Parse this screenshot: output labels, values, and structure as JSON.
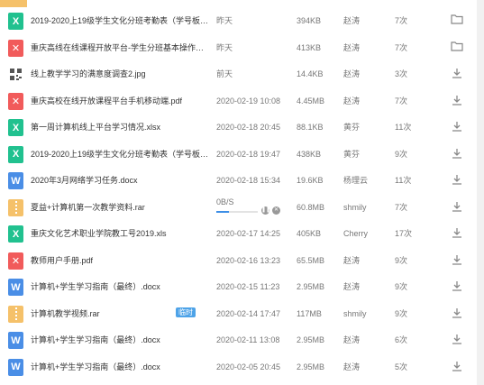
{
  "files": [
    {
      "type": "xls",
      "color": "#21c18f",
      "glyph": "X",
      "name": "2019-2020上19级学生文化分班考勤表（学号板…",
      "date": "昨天",
      "size": "394KB",
      "owner": "赵涛",
      "count": "7次",
      "action": "folder-icon"
    },
    {
      "type": "pdf",
      "color": "#f15b5b",
      "glyph": "✕",
      "name": "重庆高线在线课程开放平台-学生分班基本操作流…",
      "date": "昨天",
      "size": "413KB",
      "owner": "赵涛",
      "count": "7次",
      "action": "folder-icon"
    },
    {
      "type": "jpg",
      "color": "#777777",
      "glyph": "▦",
      "name": "线上教学学习的满意度调查2.jpg",
      "date": "前天",
      "size": "14.4KB",
      "owner": "赵涛",
      "count": "3次",
      "action": "download-icon"
    },
    {
      "type": "pdf",
      "color": "#f15b5b",
      "glyph": "✕",
      "name": "重庆高校在线开放课程平台手机移动端.pdf",
      "date": "2020-02-19 10:08",
      "size": "4.45MB",
      "owner": "赵涛",
      "count": "7次",
      "action": "download-icon"
    },
    {
      "type": "xls",
      "color": "#21c18f",
      "glyph": "X",
      "name": "第一周计算机线上平台学习情况.xlsx",
      "date": "2020-02-18 20:45",
      "size": "88.1KB",
      "owner": "黄芬",
      "count": "11次",
      "action": "download-icon"
    },
    {
      "type": "xls",
      "color": "#21c18f",
      "glyph": "X",
      "name": "2019-2020上19级学生文化分班考勤表（学号板…",
      "date": "2020-02-18 19:47",
      "size": "438KB",
      "owner": "黄芬",
      "count": "9次",
      "action": "download-icon"
    },
    {
      "type": "doc",
      "color": "#4a8ee6",
      "glyph": "W",
      "name": "2020年3月网络学习任务.docx",
      "date": "2020-02-18 15:34",
      "size": "19.6KB",
      "owner": "杨理云",
      "count": "11次",
      "action": "download-icon"
    },
    {
      "type": "rar",
      "color": "#f5c16a",
      "glyph": "▮",
      "name": "夏益+计算机第一次教学资料.rar",
      "date": "",
      "size": "60.8MB",
      "owner": "shmily",
      "count": "7次",
      "action": "download-icon",
      "progress": {
        "speed": "0B/S",
        "percent": 30
      }
    },
    {
      "type": "xls",
      "color": "#21c18f",
      "glyph": "X",
      "name": "重庆文化艺术职业学院教工号2019.xls",
      "date": "2020-02-17 14:25",
      "size": "405KB",
      "owner": "Cherry",
      "count": "17次",
      "action": "download-icon"
    },
    {
      "type": "pdf",
      "color": "#f15b5b",
      "glyph": "✕",
      "name": "教师用户手册.pdf",
      "date": "2020-02-16 13:23",
      "size": "65.5MB",
      "owner": "赵涛",
      "count": "9次",
      "action": "download-icon"
    },
    {
      "type": "doc",
      "color": "#4a8ee6",
      "glyph": "W",
      "name": "计算机+学生学习指南（最终）.docx",
      "date": "2020-02-15 11:23",
      "size": "2.95MB",
      "owner": "赵涛",
      "count": "9次",
      "action": "download-icon"
    },
    {
      "type": "rar",
      "color": "#f5c16a",
      "glyph": "▮",
      "name": "计算机教学视频.rar",
      "date": "2020-02-14 17:47",
      "size": "117MB",
      "owner": "shmily",
      "count": "9次",
      "action": "download-icon",
      "badge": "临时"
    },
    {
      "type": "doc",
      "color": "#4a8ee6",
      "glyph": "W",
      "name": "计算机+学生学习指南（最终）.docx",
      "date": "2020-02-11 13:08",
      "size": "2.95MB",
      "owner": "赵涛",
      "count": "6次",
      "action": "download-icon"
    },
    {
      "type": "doc",
      "color": "#4a8ee6",
      "glyph": "W",
      "name": "计算机+学生学习指南（最终）.docx",
      "date": "2020-02-05 20:45",
      "size": "2.95MB",
      "owner": "赵涛",
      "count": "5次",
      "action": "download-icon"
    }
  ],
  "colors": {
    "accent": "#3d8ee6",
    "muted": "#777777"
  }
}
